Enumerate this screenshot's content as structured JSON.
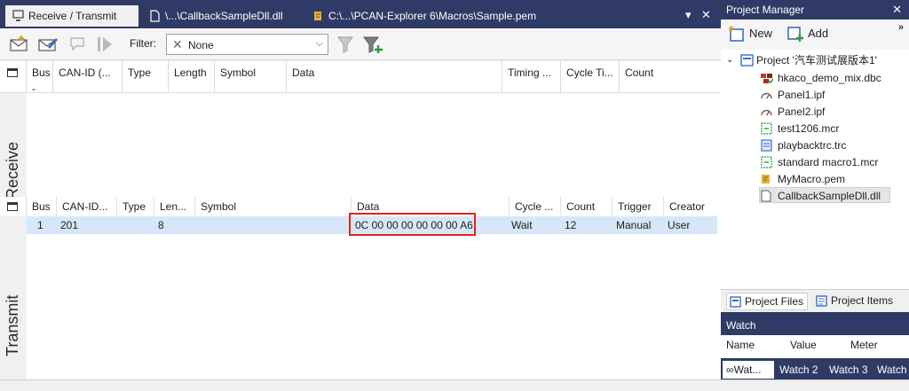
{
  "tabs": [
    {
      "label": "Receive / Transmit",
      "icon": "monitor-icon",
      "active": true
    },
    {
      "label": "\\...\\CallbackSampleDll.dll",
      "icon": "document-icon",
      "active": false
    },
    {
      "label": "C:\\...\\PCAN-Explorer 6\\Macros\\Sample.pem",
      "icon": "macro-icon",
      "active": false
    }
  ],
  "tab_controls": {
    "dropdown": "▾",
    "close": "✕"
  },
  "toolbar": {
    "filter_label": "Filter:",
    "filter_value": "None"
  },
  "receive": {
    "side_label": "Receive",
    "columns": [
      "Bus",
      "CAN-ID (...",
      "Type",
      "Length",
      "Symbol",
      "Data",
      "Timing ...",
      "Cycle Ti...",
      "Count"
    ],
    "bus_sub": "-"
  },
  "transmit": {
    "side_label": "Transmit",
    "columns": [
      "Bus",
      "CAN-ID...",
      "Type",
      "Len...",
      "Symbol",
      "Data",
      "Cycle ...",
      "Count",
      "Trigger",
      "Creator"
    ],
    "rows": [
      {
        "bus": "1",
        "can_id": "201",
        "type": "",
        "length": "8",
        "symbol": "",
        "data": "0C 00 00 00 00 00 00 A6",
        "cycle": "Wait",
        "count": "12",
        "trigger": "Manual",
        "creator": "User"
      }
    ]
  },
  "project_manager": {
    "title": "Project Manager",
    "new_label": "New",
    "add_label": "Add",
    "project_label": "Project '汽车测试展版本1'",
    "items": [
      {
        "label": "hkaco_demo_mix.dbc",
        "icon": "database-icon"
      },
      {
        "label": "Panel1.ipf",
        "icon": "gauge-icon"
      },
      {
        "label": "Panel2.ipf",
        "icon": "gauge-icon"
      },
      {
        "label": "test1206.mcr",
        "icon": "macro-file-icon"
      },
      {
        "label": "playbacktrc.trc",
        "icon": "trace-file-icon"
      },
      {
        "label": "standard macro1.mcr",
        "icon": "macro-file-icon"
      },
      {
        "label": "MyMacro.pem",
        "icon": "script-icon"
      },
      {
        "label": "CallbackSampleDll.dll",
        "icon": "dll-icon"
      }
    ],
    "bottom_tabs": [
      "Project Files",
      "Project Items"
    ]
  },
  "watch": {
    "title": "Watch",
    "columns": [
      "Name",
      "Value",
      "Meter"
    ],
    "tabs": [
      "Wat...",
      "Watch 2",
      "Watch 3",
      "Watch"
    ]
  },
  "colors": {
    "title_bar": "#2f3b66",
    "selected_row": "#d6e8f8",
    "highlight": "#e32222"
  }
}
